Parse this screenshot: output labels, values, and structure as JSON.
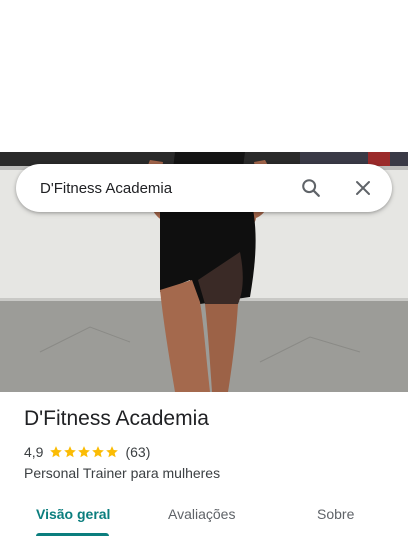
{
  "search": {
    "query": "D'Fitness Academia",
    "search_icon": "search-icon",
    "close_icon": "close-icon"
  },
  "place": {
    "name": "D'Fitness Academia",
    "rating": "4,9",
    "rating_stars": 5,
    "review_count": "(63)",
    "category": "Personal Trainer para mulheres"
  },
  "tabs": [
    {
      "label": "Visão geral",
      "active": true
    },
    {
      "label": "Avaliações",
      "active": false
    },
    {
      "label": "Sobre",
      "active": false
    }
  ],
  "colors": {
    "accent": "#0b7e7e",
    "star": "#fbbc04",
    "text_primary": "#202124",
    "text_secondary": "#3c4043"
  }
}
